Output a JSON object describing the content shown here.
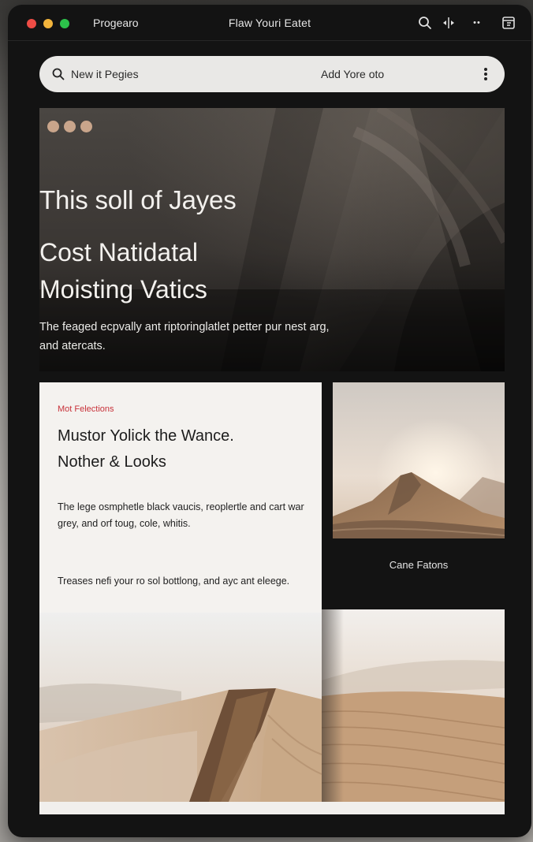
{
  "titlebar": {
    "app_name": "Progearo",
    "window_title": "Flaw Youri Eatet",
    "icons": [
      "search-icon",
      "split-view-icon",
      "more-icon",
      "sidebar-icon"
    ],
    "more_glyph": "••"
  },
  "search": {
    "placeholder": "New it Pegies",
    "add_label": "Add Yore oto"
  },
  "hero": {
    "title": "This soll of Jayes",
    "subtitle_line1": "Cost Natidatal",
    "subtitle_line2": "Moisting Vatics",
    "description": "The feaged ecpvally ant riptoringlatlet petter pur nest arg, and atercats.",
    "dot_color": "#c9a58b"
  },
  "card": {
    "kicker": "Mot Felections",
    "headline_line1": "Mustor Yolick the Wance.",
    "headline_line2": "Nother & Looks",
    "body": "The lege osmphetle black vaucis, reoplertle and cart war grey, and orf toug, cole, whitis.",
    "footer": "Treases nefi your ro sol bottlong, and ayc ant eleege.",
    "accent_color": "#c8323a"
  },
  "gallery": {
    "caption": "Cane Fatons"
  }
}
